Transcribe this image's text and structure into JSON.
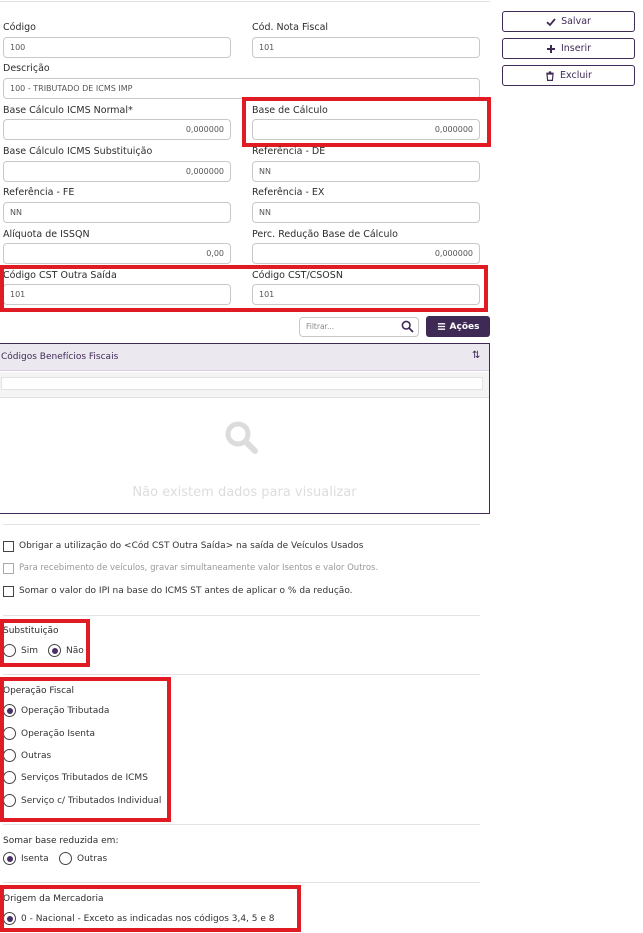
{
  "toolbar": {
    "save_label": "Salvar",
    "insert_label": "Inserir",
    "delete_label": "Excluir"
  },
  "form": {
    "codigo": {
      "label": "Código",
      "value": "100"
    },
    "cod_nota_fiscal": {
      "label": "Cód. Nota Fiscal",
      "value": "101"
    },
    "descricao": {
      "label": "Descrição",
      "value": "100 - TRIBUTADO DE ICMS IMP"
    },
    "base_calculo_icms_normal": {
      "label": "Base Cálculo ICMS Normal*",
      "value": "0,000000"
    },
    "base_de_calculo": {
      "label": "Base de Cálculo",
      "value": "0,000000"
    },
    "base_calculo_icms_st": {
      "label": "Base Cálculo ICMS Substituição",
      "value": "0,000000"
    },
    "referencia_de": {
      "label": "Referência - DE",
      "value": "NN"
    },
    "referencia_fe": {
      "label": "Referência - FE",
      "value": "NN"
    },
    "referencia_ex": {
      "label": "Referência - EX",
      "value": "NN"
    },
    "aliquota_issqn": {
      "label": "Alíquota de ISSQN",
      "value": "0,00"
    },
    "perc_reducao": {
      "label": "Perc. Redução Base de Cálculo",
      "value": "0,000000"
    },
    "cst_outra_saida": {
      "label": "Código CST Outra Saída",
      "value": "101"
    },
    "cst_csosn": {
      "label": "Código CST/CSOSN",
      "value": "101"
    }
  },
  "grid": {
    "filter_placeholder": "Filtrar...",
    "actions_label": "Ações",
    "column_header": "Códigos Benefícios Fiscais",
    "empty_message": "Não existem dados para visualizar"
  },
  "checkboxes": [
    {
      "label": "Obrigar a utilização do <Cód CST Outra Saída> na saída de Veículos Usados",
      "checked": false,
      "disabled": false
    },
    {
      "label": "Para recebimento de veículos, gravar simultaneamente valor Isentos e valor Outros.",
      "checked": false,
      "disabled": true
    },
    {
      "label": "Somar o valor do IPI na base do ICMS ST antes de aplicar o % da redução.",
      "checked": false,
      "disabled": false
    }
  ],
  "substituicao": {
    "title": "Substituição",
    "options": [
      "Sim",
      "Não"
    ],
    "selected": "Não"
  },
  "operacao_fiscal": {
    "title": "Operação Fiscal",
    "options": [
      "Operação Tributada",
      "Operação Isenta",
      "Outras",
      "Serviços Tributados de ICMS",
      "Serviço c/ Tributados Individual"
    ],
    "selected": "Operação Tributada"
  },
  "somar_base": {
    "title": "Somar base reduzida em:",
    "options": [
      "Isenta",
      "Outras"
    ],
    "selected": "Isenta"
  },
  "origem": {
    "title": "Origem da Mercadoria",
    "options": [
      "0 - Nacional - Exceto as indicadas nos códigos 3,4, 5 e 8"
    ],
    "selected": "0 - Nacional - Exceto as indicadas nos códigos 3,4, 5 e 8"
  },
  "colors": {
    "accent": "#3f2a56",
    "highlight": "#e01b24"
  }
}
